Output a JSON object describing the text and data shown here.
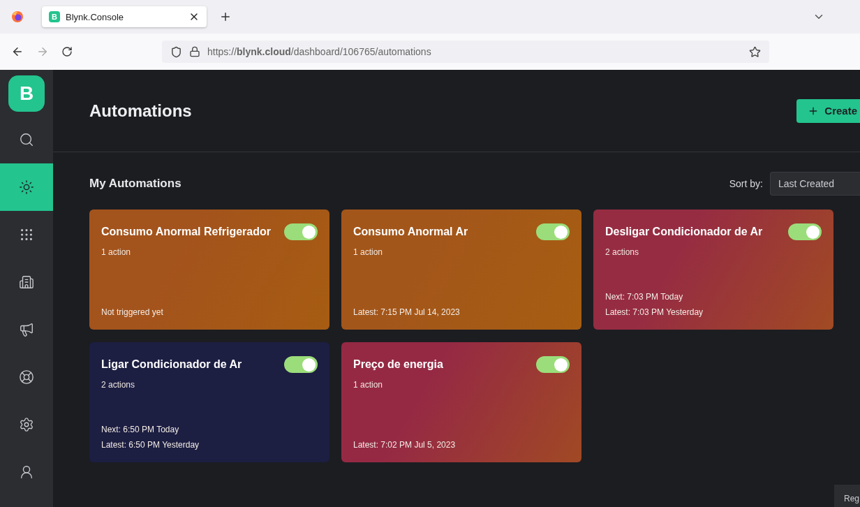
{
  "browser": {
    "tab_title": "Blynk.Console",
    "tab_favicon": "B",
    "url": "https://**blynk.cloud**/dashboard/106765/automations"
  },
  "sidebar": {
    "logo": "B",
    "items": [
      {
        "selected": false
      },
      {
        "selected": true
      },
      {
        "selected": false
      },
      {
        "selected": false
      },
      {
        "selected": false
      },
      {
        "selected": false
      },
      {
        "selected": false
      },
      {
        "selected": false
      }
    ]
  },
  "header": {
    "title": "Automations",
    "create_button": "Create"
  },
  "section": {
    "title": "My Automations",
    "sort_label": "Sort by:",
    "sort_value": "Last Created"
  },
  "cards": [
    {
      "title": "Consumo Anormal Refrigerador",
      "subtitle": "1 action",
      "on": true,
      "color": "#a3531c",
      "lines": [
        "Not triggered yet"
      ]
    },
    {
      "title": "Consumo Anormal Ar",
      "subtitle": "1 action",
      "on": true,
      "color": "#a3561a",
      "lines": [
        "Latest: 7:15 PM Jul 14, 2023"
      ]
    },
    {
      "title": "Desligar Condicionador de Ar",
      "subtitle": "2 actions",
      "on": true,
      "color": "#962c42",
      "lines": [
        "Next: 7:03 PM Today",
        "Latest: 7:03 PM Yesterday"
      ]
    },
    {
      "title": "Ligar Condicionador de Ar",
      "subtitle": "2 actions",
      "on": true,
      "color": "#1c1e42",
      "lines": [
        "Next: 6:50 PM Today",
        "Latest: 6:50 PM Yesterday"
      ]
    },
    {
      "title": "Preço de energia",
      "subtitle": "1 action",
      "on": true,
      "color": "#952944",
      "lines": [
        "Latest: 7:02 PM Jul 5, 2023"
      ]
    }
  ],
  "corner_button": "Reg"
}
